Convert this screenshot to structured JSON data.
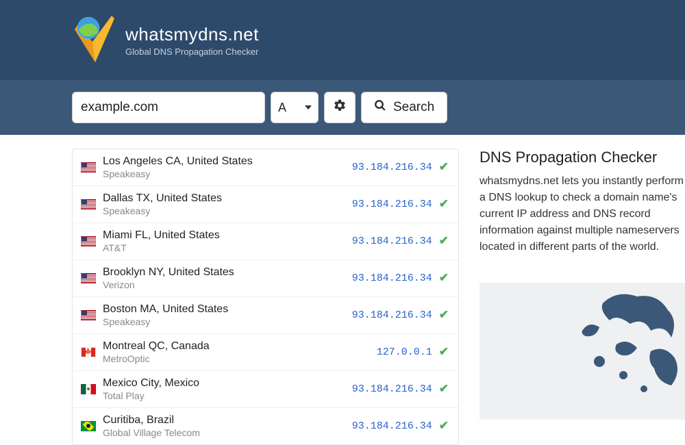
{
  "brand": {
    "name": "whatsmydns.net",
    "tagline": "Global DNS Propagation Checker"
  },
  "search": {
    "domain_value": "example.com",
    "record_type": "A",
    "search_label": "Search"
  },
  "results": [
    {
      "flag": "us",
      "location": "Los Angeles CA, United States",
      "isp": "Speakeasy",
      "ip": "93.184.216.34",
      "status": "ok"
    },
    {
      "flag": "us",
      "location": "Dallas TX, United States",
      "isp": "Speakeasy",
      "ip": "93.184.216.34",
      "status": "ok"
    },
    {
      "flag": "us",
      "location": "Miami FL, United States",
      "isp": "AT&T",
      "ip": "93.184.216.34",
      "status": "ok"
    },
    {
      "flag": "us",
      "location": "Brooklyn NY, United States",
      "isp": "Verizon",
      "ip": "93.184.216.34",
      "status": "ok"
    },
    {
      "flag": "us",
      "location": "Boston MA, United States",
      "isp": "Speakeasy",
      "ip": "93.184.216.34",
      "status": "ok"
    },
    {
      "flag": "ca",
      "location": "Montreal QC, Canada",
      "isp": "MetroOptic",
      "ip": "127.0.0.1",
      "status": "ok"
    },
    {
      "flag": "mx",
      "location": "Mexico City, Mexico",
      "isp": "Total Play",
      "ip": "93.184.216.34",
      "status": "ok"
    },
    {
      "flag": "br",
      "location": "Curitiba, Brazil",
      "isp": "Global Village Telecom",
      "ip": "93.184.216.34",
      "status": "ok"
    }
  ],
  "sidebar": {
    "heading": "DNS Propagation Checker",
    "body": "whatsmydns.net lets you instantly perform a DNS lookup to check a domain name's current IP address and DNS record information against multiple nameservers located in different parts of the world."
  }
}
